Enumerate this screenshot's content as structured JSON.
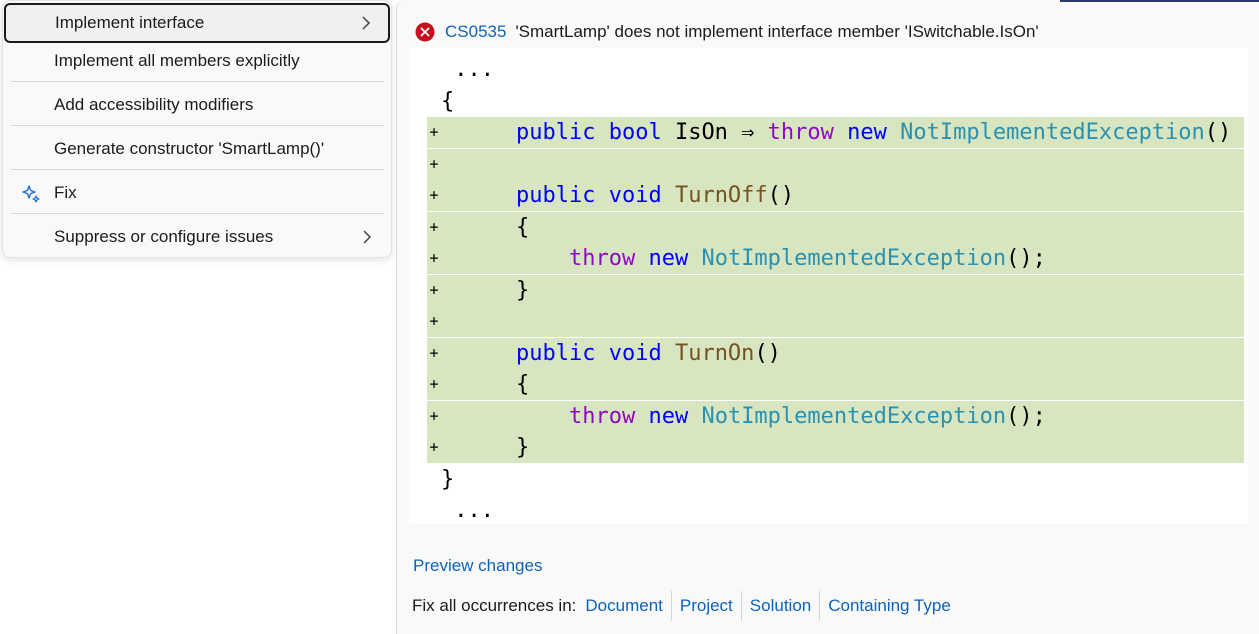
{
  "menu": {
    "items": [
      {
        "label": "Implement interface",
        "has_submenu": true,
        "selected": true
      },
      {
        "label": "Implement all members explicitly",
        "has_submenu": false
      },
      {
        "label": "Add accessibility modifiers",
        "has_submenu": false
      },
      {
        "label": "Generate constructor 'SmartLamp()'",
        "has_submenu": false
      },
      {
        "label": "Fix",
        "has_submenu": false,
        "icon": "sparkle-fix-icon"
      },
      {
        "label": "Suppress or configure issues",
        "has_submenu": true
      }
    ]
  },
  "diagnostic": {
    "icon": "error-icon",
    "code": "CS0535",
    "message": "'SmartLamp' does not implement interface member 'ISwitchable.IsOn'"
  },
  "code_preview": {
    "lines": [
      {
        "kind": "context",
        "text": " ..."
      },
      {
        "kind": "context",
        "text": "{"
      },
      {
        "kind": "added",
        "marker": "+",
        "indent": "    ",
        "tokens": [
          [
            "kw",
            "public"
          ],
          [
            "p",
            " "
          ],
          [
            "kw",
            "bool"
          ],
          [
            "p",
            " IsOn ⇒ "
          ],
          [
            "ctl",
            "throw"
          ],
          [
            "p",
            " "
          ],
          [
            "kw",
            "new"
          ],
          [
            "p",
            " "
          ],
          [
            "type",
            "NotImplementedException"
          ],
          [
            "p",
            "()"
          ]
        ]
      },
      {
        "kind": "added",
        "marker": "+",
        "indent": "",
        "tokens": []
      },
      {
        "kind": "added",
        "marker": "+",
        "indent": "    ",
        "tokens": [
          [
            "kw",
            "public"
          ],
          [
            "p",
            " "
          ],
          [
            "kw",
            "void"
          ],
          [
            "p",
            " "
          ],
          [
            "meth",
            "TurnOff"
          ],
          [
            "p",
            "()"
          ]
        ]
      },
      {
        "kind": "added",
        "marker": "+",
        "indent": "    ",
        "tokens": [
          [
            "p",
            "{"
          ]
        ]
      },
      {
        "kind": "added",
        "marker": "+",
        "indent": "        ",
        "tokens": [
          [
            "ctl",
            "throw"
          ],
          [
            "p",
            " "
          ],
          [
            "kw",
            "new"
          ],
          [
            "p",
            " "
          ],
          [
            "type",
            "NotImplementedException"
          ],
          [
            "p",
            "();"
          ]
        ]
      },
      {
        "kind": "added",
        "marker": "+",
        "indent": "    ",
        "tokens": [
          [
            "p",
            "}"
          ]
        ]
      },
      {
        "kind": "added",
        "marker": "+",
        "indent": "",
        "tokens": []
      },
      {
        "kind": "added",
        "marker": "+",
        "indent": "    ",
        "tokens": [
          [
            "kw",
            "public"
          ],
          [
            "p",
            " "
          ],
          [
            "kw",
            "void"
          ],
          [
            "p",
            " "
          ],
          [
            "meth",
            "TurnOn"
          ],
          [
            "p",
            "()"
          ]
        ]
      },
      {
        "kind": "added",
        "marker": "+",
        "indent": "    ",
        "tokens": [
          [
            "p",
            "{"
          ]
        ]
      },
      {
        "kind": "added",
        "marker": "+",
        "indent": "        ",
        "tokens": [
          [
            "ctl",
            "throw"
          ],
          [
            "p",
            " "
          ],
          [
            "kw",
            "new"
          ],
          [
            "p",
            " "
          ],
          [
            "type",
            "NotImplementedException"
          ],
          [
            "p",
            "();"
          ]
        ]
      },
      {
        "kind": "added",
        "marker": "+",
        "indent": "    ",
        "tokens": [
          [
            "p",
            "}"
          ]
        ]
      },
      {
        "kind": "context",
        "text": "}"
      },
      {
        "kind": "context",
        "text": " ..."
      }
    ]
  },
  "preview_changes_label": "Preview changes",
  "fix_all": {
    "label": "Fix all occurrences in:",
    "scopes": [
      "Document",
      "Project",
      "Solution",
      "Containing Type"
    ]
  },
  "colors": {
    "added_background": "#d8e5c1",
    "keyword": "#0000ff",
    "control_keyword": "#8f08c4",
    "type_name": "#2b91af",
    "method_name": "#74531f",
    "link": "#0e63b5",
    "error": "#c50f1f"
  }
}
